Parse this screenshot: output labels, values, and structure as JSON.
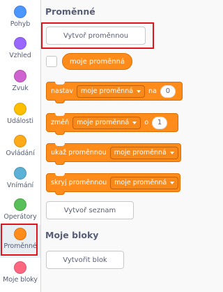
{
  "categories": [
    {
      "label": "Pohyb",
      "color": "#4c97ff"
    },
    {
      "label": "Vzhled",
      "color": "#9966ff"
    },
    {
      "label": "Zvuk",
      "color": "#cf63cf"
    },
    {
      "label": "Události",
      "color": "#ffbf00"
    },
    {
      "label": "Ovládání",
      "color": "#ffab19"
    },
    {
      "label": "Vnímání",
      "color": "#5cb1d6"
    },
    {
      "label": "Operátory",
      "color": "#59c059"
    },
    {
      "label": "Proměnné",
      "color": "#ff8c1a"
    },
    {
      "label": "Moje bloky",
      "color": "#ff6680"
    }
  ],
  "selected_category": "Proměnné",
  "palette": {
    "variables_heading": "Proměnné",
    "make_variable_button": "Vytvoř proměnnou",
    "variable_reporter": "moje proměnná",
    "set_block": {
      "label": "nastav",
      "variable": "moje proměnná",
      "to_label": "na",
      "value": "0"
    },
    "change_block": {
      "label": "změň",
      "variable": "moje proměnná",
      "by_label": "o",
      "value": "1"
    },
    "show_block": {
      "label": "ukaž proměnnou",
      "variable": "moje proměnná"
    },
    "hide_block": {
      "label": "skryj proměnnou",
      "variable": "moje proměnná"
    },
    "make_list_button": "Vytvoř seznam",
    "my_blocks_heading": "Moje bloky",
    "make_block_button": "Vytvořit blok"
  },
  "colors": {
    "variables": "#ff8c1a",
    "variables_border": "#db6e00",
    "highlight": "#e0151b",
    "text": "#575e75"
  }
}
